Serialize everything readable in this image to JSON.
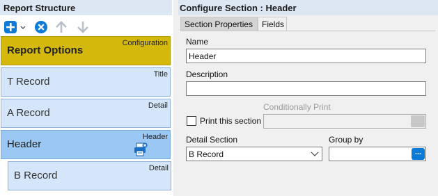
{
  "left_panel": {
    "title": "Report Structure",
    "toolbar": {
      "add_icon": "plus-circle-icon",
      "dropdown_icon": "chevron-down-icon",
      "remove_icon": "x-circle-icon",
      "move_up_icon": "arrow-up-icon",
      "move_down_icon": "arrow-down-icon"
    },
    "sections": [
      {
        "name": "Report Options",
        "tag": "Configuration",
        "state": "config"
      },
      {
        "name": "T Record",
        "tag": "Title",
        "state": "normal"
      },
      {
        "name": "A Record",
        "tag": "Detail",
        "state": "normal"
      },
      {
        "name": "Header",
        "tag": "Header",
        "state": "selected",
        "icon": "printer-icon"
      },
      {
        "name": "B Record",
        "tag": "Detail",
        "state": "normal"
      }
    ]
  },
  "right_panel": {
    "title": "Configure Section : Header",
    "tabs": [
      {
        "label": "Section Properties",
        "active": true
      },
      {
        "label": "Fields",
        "active": false
      }
    ],
    "form": {
      "name_label": "Name",
      "name_value": "Header",
      "description_label": "Description",
      "description_value": "",
      "conditionally_print_label": "Conditionally Print",
      "print_checkbox_label": "Print this section",
      "print_checked": false,
      "detail_section_label": "Detail Section",
      "detail_section_value": "B Record",
      "group_by_label": "Group by",
      "group_by_value": "",
      "group_by_button": "...",
      "condition_button": ""
    }
  },
  "colors": {
    "header_bg": "#dde7f3",
    "config_section": "#d4b90c",
    "section_bg": "#d6e6fa",
    "selected_section": "#9ac7f3",
    "accent_blue": "#0c7ad6"
  }
}
